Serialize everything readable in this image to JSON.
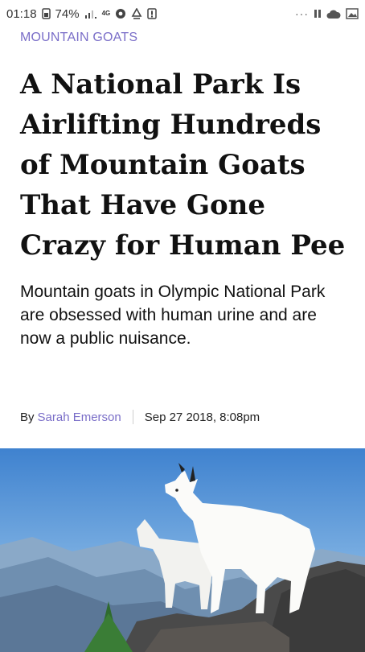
{
  "status_bar": {
    "time": "01:18",
    "battery": "74%",
    "network": "4G",
    "overflow": "···"
  },
  "article": {
    "category": "MOUNTAIN GOATS",
    "headline": "A National Park Is Airlifting Hundreds of Mountain Goats That Have Gone Crazy for Human Pee",
    "dek": "Mountain goats in Olympic National Park are obsessed with human urine and are now a public nuisance.",
    "byline_prefix": "By",
    "author": "Sarah Emerson",
    "date": "Sep 27 2018, 8:08pm"
  },
  "colors": {
    "accent": "#7a6ec8",
    "text": "#111111",
    "sky": "#4f8fd4"
  },
  "icons": [
    "card-icon",
    "signal-icon",
    "notification-icon",
    "recycle-icon",
    "alert-icon",
    "pause-icon",
    "cloud-icon",
    "image-icon"
  ]
}
